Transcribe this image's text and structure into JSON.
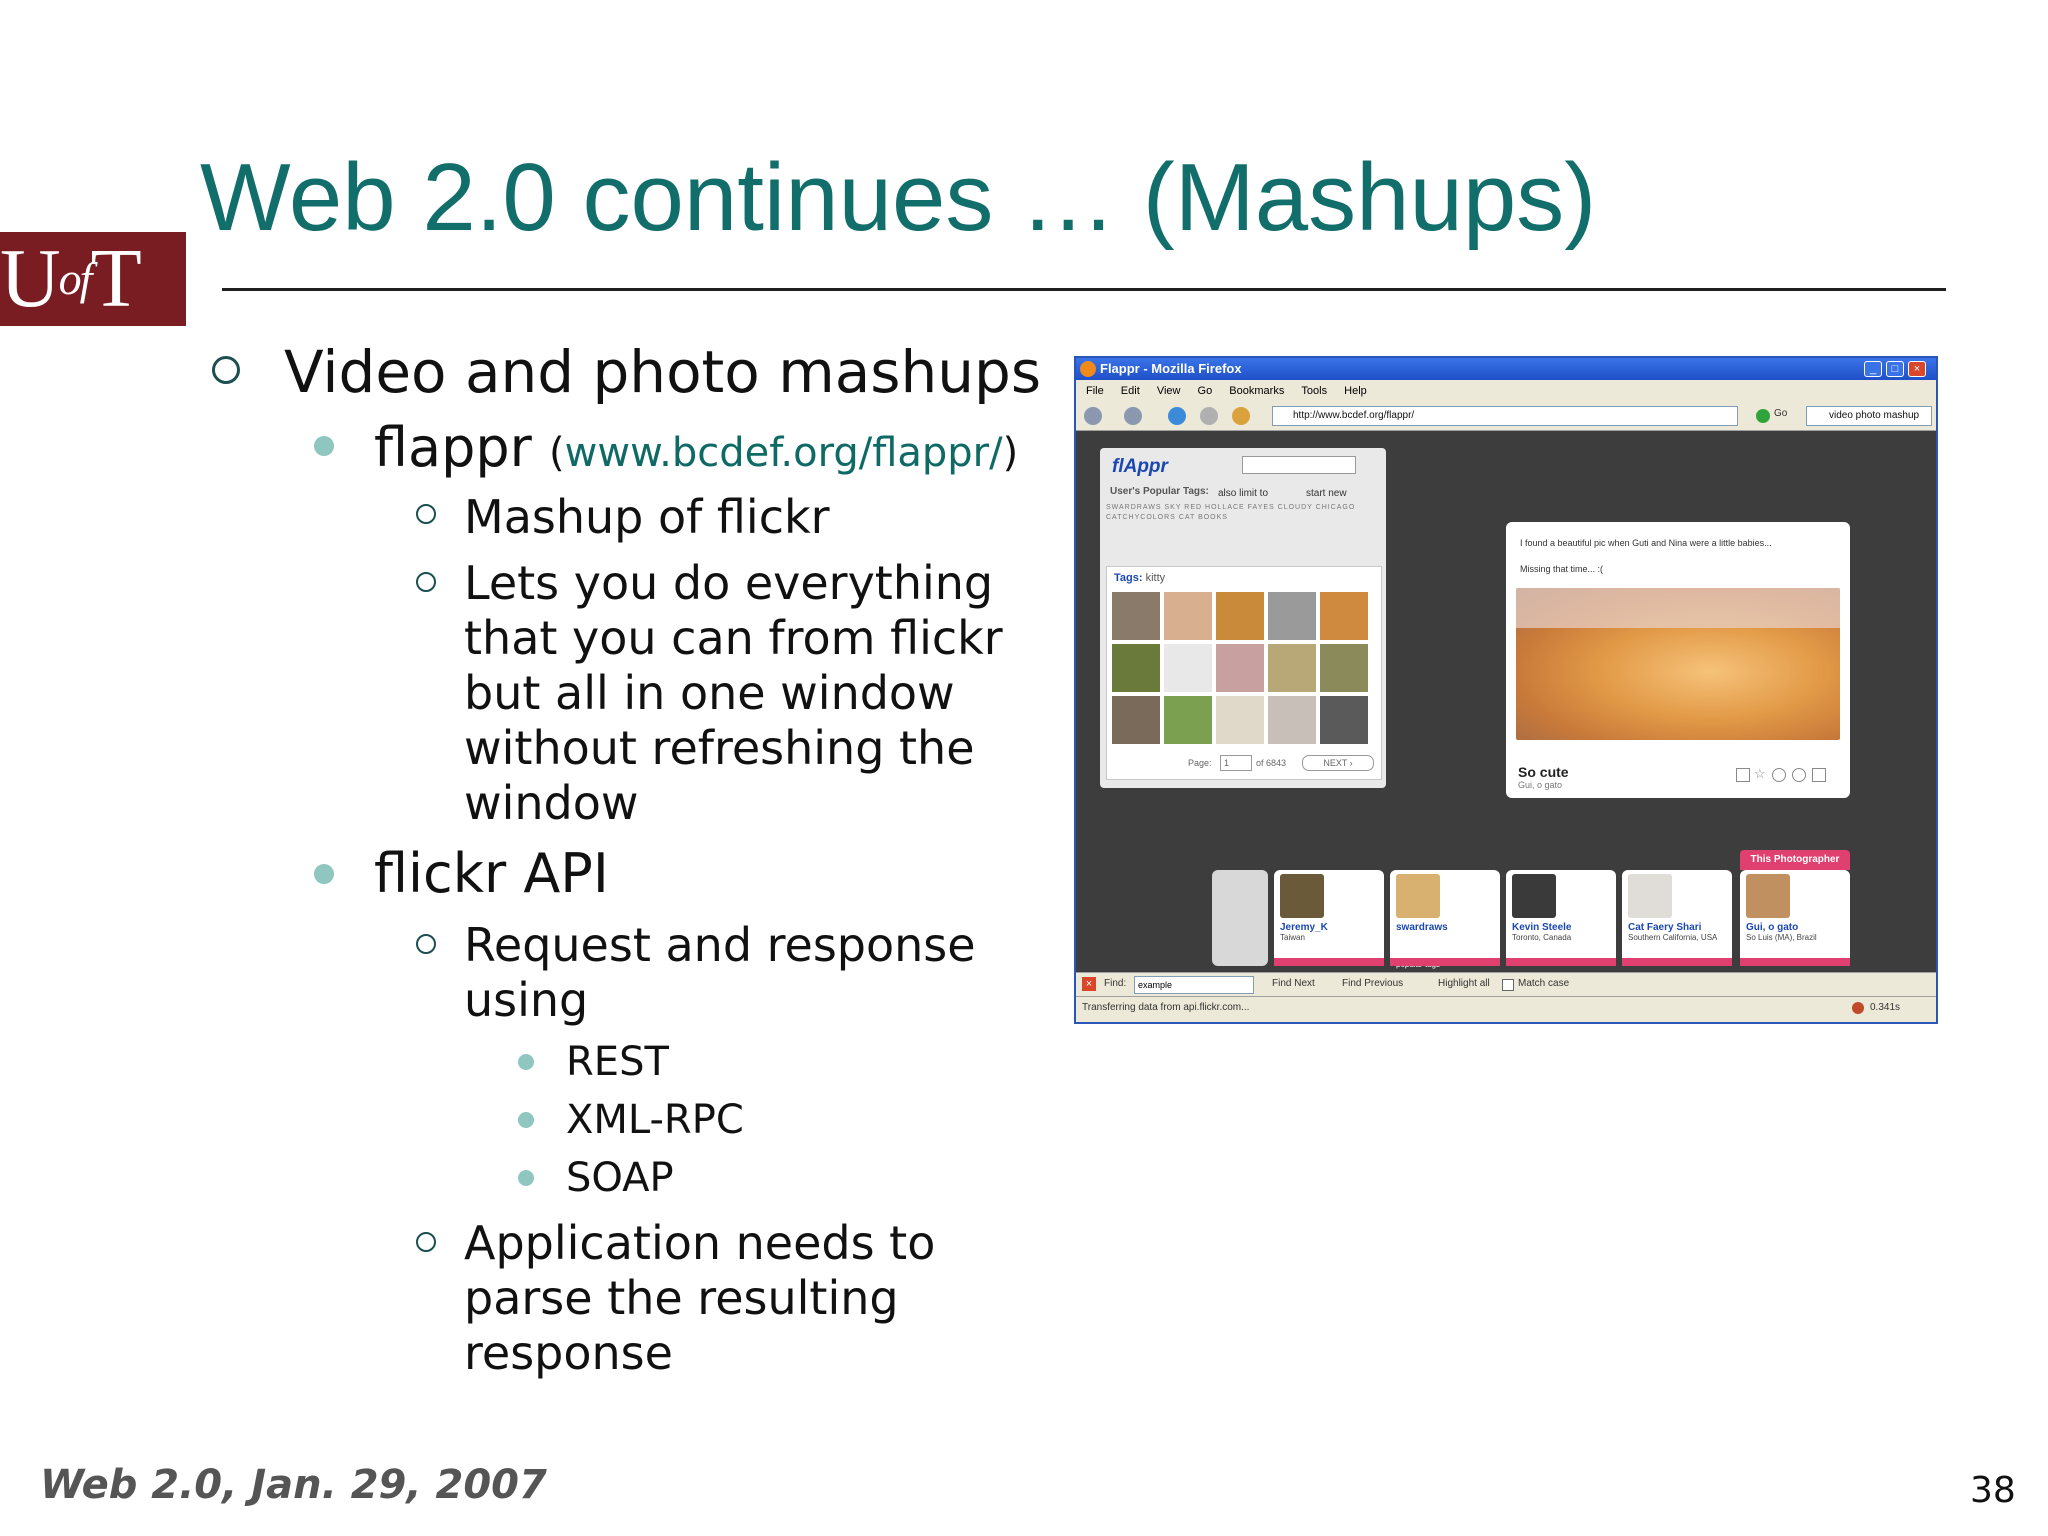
{
  "slide": {
    "title": "Web 2.0 continues … (Mashups)",
    "logo_text_u": "U",
    "logo_text_of": "of",
    "logo_text_t": "T",
    "footer": "Web 2.0, Jan. 29, 2007",
    "page_number": "38"
  },
  "bullets": {
    "video_photo": "Video and photo mashups",
    "flappr": "flappr",
    "flappr_url": "www.bcdef.org/flappr/",
    "paren_open": "(",
    "paren_close": ")",
    "mashup_of_flickr": "Mashup of flickr",
    "lets_you": [
      "Lets you do everything",
      "that you can from flickr",
      "but all in one window",
      "without refreshing the",
      "window"
    ],
    "flickr_api": "flickr API",
    "request_response": [
      "Request and response",
      "using"
    ],
    "protocols": [
      "REST",
      "XML-RPC",
      "SOAP"
    ],
    "application_needs": [
      "Application needs to",
      "parse the resulting",
      "response"
    ]
  },
  "screenshot": {
    "window_title": "Flappr - Mozilla Firefox",
    "menu": [
      "File",
      "Edit",
      "View",
      "Go",
      "Bookmarks",
      "Tools",
      "Help"
    ],
    "address": "http://www.bcdef.org/flappr/",
    "go_label": "Go",
    "search_value": "video photo mashup",
    "app_logo": "flAppr",
    "popular_tags_label": "User's Popular Tags:",
    "also_limit": "also limit to",
    "start_new": "start new",
    "tag_words_1": "SWARDRAWS SKY RED HOLLACE FAYES CLOUDY CHICAGO",
    "tag_words_2": "CATCHYCOLORS CAT BOOKS",
    "tags_label": "Tags:",
    "tags_value": "kitty",
    "page_label": "Page:",
    "page_value": "1",
    "page_of": "of 6843",
    "next_label": "NEXT ›",
    "photo_caption_1": "I found a beautiful pic when Guti and Nina were a little babies...",
    "photo_caption_2": "Missing that time... :(",
    "photo_title": "So cute",
    "photo_subtitle": "Gui, o gato",
    "this_photographer": "This Photographer",
    "popular_tags_tab": "popular tags",
    "users": [
      {
        "name": "Jeremy_K",
        "loc": "Taiwan"
      },
      {
        "name": "swardraws",
        "loc": ""
      },
      {
        "name": "Kevin Steele",
        "loc": "Toronto, Canada"
      },
      {
        "name": "Cat Faery Shari",
        "loc": "Southern California, USA"
      },
      {
        "name": "Gui, o gato",
        "loc": "So Luis (MA), Brazil"
      }
    ],
    "find_label": "Find:",
    "find_value": "example",
    "find_next": "Find Next",
    "find_previous": "Find Previous",
    "highlight_all": "Highlight all",
    "match_case": "Match case",
    "status_text": "Transferring data from api.flickr.com...",
    "status_time": "0.341s"
  },
  "colors": {
    "title": "#126e6a",
    "logo_bg": "#7a1d22",
    "bullet_dot": "#8fc6c0",
    "ring": "#1d4f52"
  }
}
